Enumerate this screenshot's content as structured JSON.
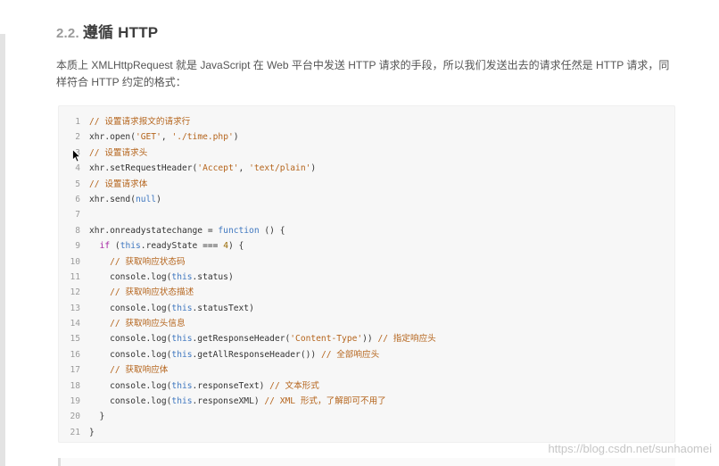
{
  "heading": {
    "number": "2.2.",
    "title": "遵循 HTTP"
  },
  "paragraph": "本质上 XMLHttpRequest 就是 JavaScript 在 Web 平台中发送 HTTP 请求的手段，所以我们发送出去的请求任然是 HTTP 请求，同样符合 HTTP 约定的格式：",
  "code_lines": [
    {
      "n": "1",
      "tokens": [
        [
          "comment",
          "// 设置请求报文的请求行"
        ]
      ]
    },
    {
      "n": "2",
      "tokens": [
        [
          "plain",
          "xhr.open("
        ],
        [
          "str",
          "'GET'"
        ],
        [
          "plain",
          ", "
        ],
        [
          "str",
          "'./time.php'"
        ],
        [
          "plain",
          ")"
        ]
      ]
    },
    {
      "n": "3",
      "tokens": [
        [
          "comment",
          "// 设置请求头"
        ]
      ]
    },
    {
      "n": "4",
      "tokens": [
        [
          "plain",
          "xhr.setRequestHeader("
        ],
        [
          "str",
          "'Accept'"
        ],
        [
          "plain",
          ", "
        ],
        [
          "str",
          "'text/plain'"
        ],
        [
          "plain",
          ")"
        ]
      ]
    },
    {
      "n": "5",
      "tokens": [
        [
          "comment",
          "// 设置请求体"
        ]
      ]
    },
    {
      "n": "6",
      "tokens": [
        [
          "plain",
          "xhr.send("
        ],
        [
          "thisk",
          "null"
        ],
        [
          "plain",
          ")"
        ]
      ]
    },
    {
      "n": "7",
      "tokens": [
        [
          "plain",
          ""
        ]
      ]
    },
    {
      "n": "8",
      "tokens": [
        [
          "plain",
          "xhr.onreadystatechange = "
        ],
        [
          "thisk",
          "function"
        ],
        [
          "plain",
          " () {"
        ]
      ]
    },
    {
      "n": "9",
      "tokens": [
        [
          "plain",
          "  "
        ],
        [
          "kw",
          "if"
        ],
        [
          "plain",
          " ("
        ],
        [
          "thisk",
          "this"
        ],
        [
          "plain",
          ".readyState === "
        ],
        [
          "num-lit",
          "4"
        ],
        [
          "plain",
          ") {"
        ]
      ]
    },
    {
      "n": "10",
      "tokens": [
        [
          "plain",
          "    "
        ],
        [
          "comment",
          "// 获取响应状态码"
        ]
      ]
    },
    {
      "n": "11",
      "tokens": [
        [
          "plain",
          "    console.log("
        ],
        [
          "thisk",
          "this"
        ],
        [
          "plain",
          ".status)"
        ]
      ]
    },
    {
      "n": "12",
      "tokens": [
        [
          "plain",
          "    "
        ],
        [
          "comment",
          "// 获取响应状态描述"
        ]
      ]
    },
    {
      "n": "13",
      "tokens": [
        [
          "plain",
          "    console.log("
        ],
        [
          "thisk",
          "this"
        ],
        [
          "plain",
          ".statusText)"
        ]
      ]
    },
    {
      "n": "14",
      "tokens": [
        [
          "plain",
          "    "
        ],
        [
          "comment",
          "// 获取响应头信息"
        ]
      ]
    },
    {
      "n": "15",
      "tokens": [
        [
          "plain",
          "    console.log("
        ],
        [
          "thisk",
          "this"
        ],
        [
          "plain",
          ".getResponseHeader("
        ],
        [
          "str",
          "'Content-Type'"
        ],
        [
          "plain",
          ")) "
        ],
        [
          "comment",
          "// 指定响应头"
        ]
      ]
    },
    {
      "n": "16",
      "tokens": [
        [
          "plain",
          "    console.log("
        ],
        [
          "thisk",
          "this"
        ],
        [
          "plain",
          ".getAllResponseHeader()) "
        ],
        [
          "comment",
          "// 全部响应头"
        ]
      ]
    },
    {
      "n": "17",
      "tokens": [
        [
          "plain",
          "    "
        ],
        [
          "comment",
          "// 获取响应体"
        ]
      ]
    },
    {
      "n": "18",
      "tokens": [
        [
          "plain",
          "    console.log("
        ],
        [
          "thisk",
          "this"
        ],
        [
          "plain",
          ".responseText) "
        ],
        [
          "comment",
          "// 文本形式"
        ]
      ]
    },
    {
      "n": "19",
      "tokens": [
        [
          "plain",
          "    console.log("
        ],
        [
          "thisk",
          "this"
        ],
        [
          "plain",
          ".responseXML) "
        ],
        [
          "comment",
          "// XML 形式，了解即可不用了"
        ]
      ]
    },
    {
      "n": "20",
      "tokens": [
        [
          "plain",
          "  }"
        ]
      ]
    },
    {
      "n": "21",
      "tokens": [
        [
          "plain",
          "}"
        ]
      ]
    }
  ],
  "watermark": "https://blog.csdn.net/sunhaomei"
}
